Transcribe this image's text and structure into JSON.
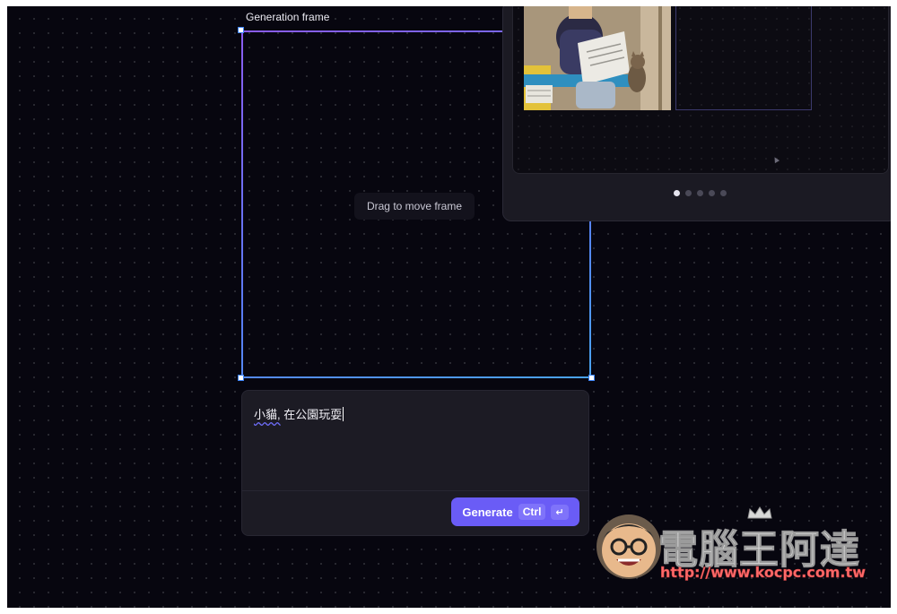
{
  "frame": {
    "label": "Generation frame",
    "drag_tooltip": "Drag to move frame"
  },
  "gallery": {
    "page_count": 5,
    "active_page": 1
  },
  "prompt": {
    "text_underlined": "小貓,",
    "text_rest": " 在公園玩耍"
  },
  "generate_button": {
    "label": "Generate",
    "shortcut": "Ctrl",
    "enter_symbol": "↵"
  },
  "watermark": {
    "title": "電腦王阿達",
    "url": "http://www.kocpc.com.tw"
  },
  "colors": {
    "accent": "#6a5cf6",
    "canvas_bg": "#07060f"
  }
}
